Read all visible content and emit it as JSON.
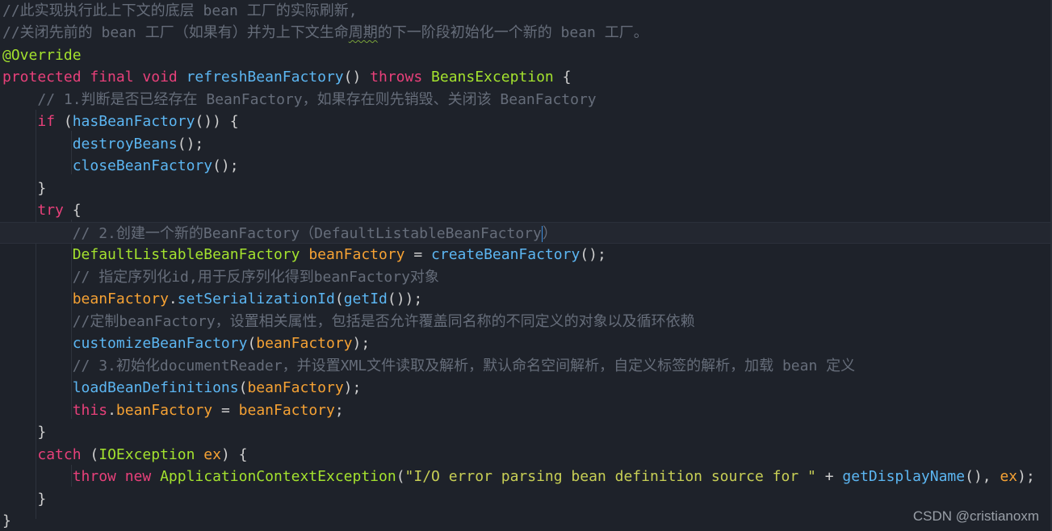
{
  "editor": {
    "lines": [
      {
        "indent": "",
        "tokens": [
          {
            "t": "cm",
            "v": "//此实现执行此上下文的底层 bean 工厂的实际刷新,"
          }
        ]
      },
      {
        "indent": "",
        "tokens": [
          {
            "t": "cm",
            "v": "//关闭先前的 bean 工厂（如果有）并为上下文生命周期的下一阶段初始化一个新的 bean 工厂。"
          }
        ]
      },
      {
        "indent": "",
        "tokens": [
          {
            "t": "ann",
            "v": "@Override"
          }
        ]
      },
      {
        "indent": "",
        "tokens": [
          {
            "t": "kw",
            "v": "protected final void "
          },
          {
            "t": "fn",
            "v": "refreshBeanFactory"
          },
          {
            "t": "pn",
            "v": "() "
          },
          {
            "t": "kw",
            "v": "throws "
          },
          {
            "t": "ty",
            "v": "BeansException"
          },
          {
            "t": "pn",
            "v": " {"
          }
        ]
      },
      {
        "indent": "    ",
        "tokens": [
          {
            "t": "cm",
            "v": "// 1.判断是否已经存在 BeanFactory，如果存在则先销毁、关闭该 BeanFactory"
          }
        ]
      },
      {
        "indent": "    ",
        "tokens": [
          {
            "t": "kw",
            "v": "if "
          },
          {
            "t": "pn",
            "v": "("
          },
          {
            "t": "fn",
            "v": "hasBeanFactory"
          },
          {
            "t": "pn",
            "v": "()) {"
          }
        ]
      },
      {
        "indent": "        ",
        "tokens": [
          {
            "t": "fn",
            "v": "destroyBeans"
          },
          {
            "t": "pn",
            "v": "();"
          }
        ]
      },
      {
        "indent": "        ",
        "tokens": [
          {
            "t": "fn",
            "v": "closeBeanFactory"
          },
          {
            "t": "pn",
            "v": "();"
          }
        ]
      },
      {
        "indent": "    ",
        "tokens": [
          {
            "t": "pn",
            "v": "}"
          }
        ]
      },
      {
        "indent": "    ",
        "tokens": [
          {
            "t": "kw",
            "v": "try "
          },
          {
            "t": "pn",
            "v": "{"
          }
        ]
      },
      {
        "indent": "        ",
        "tokens": [
          {
            "t": "cm",
            "v": "// 2.创建一个新的BeanFactory（DefaultListableBeanFactory"
          },
          {
            "t": "caret",
            "v": ""
          },
          {
            "t": "cm",
            "v": "）"
          }
        ]
      },
      {
        "indent": "        ",
        "tokens": [
          {
            "t": "ty",
            "v": "DefaultListableBeanFactory "
          },
          {
            "t": "va",
            "v": "beanFactory"
          },
          {
            "t": "pn",
            "v": " = "
          },
          {
            "t": "fn",
            "v": "createBeanFactory"
          },
          {
            "t": "pn",
            "v": "();"
          }
        ]
      },
      {
        "indent": "        ",
        "tokens": [
          {
            "t": "cm",
            "v": "// 指定序列化id,用于反序列化得到beanFactory对象"
          }
        ]
      },
      {
        "indent": "        ",
        "tokens": [
          {
            "t": "va",
            "v": "beanFactory"
          },
          {
            "t": "pn",
            "v": "."
          },
          {
            "t": "fn",
            "v": "setSerializationId"
          },
          {
            "t": "pn",
            "v": "("
          },
          {
            "t": "fn",
            "v": "getId"
          },
          {
            "t": "pn",
            "v": "());"
          }
        ]
      },
      {
        "indent": "        ",
        "tokens": [
          {
            "t": "cm",
            "v": "//定制beanFactory，设置相关属性，包括是否允许覆盖同名称的不同定义的对象以及循环依赖"
          }
        ]
      },
      {
        "indent": "        ",
        "tokens": [
          {
            "t": "fn",
            "v": "customizeBeanFactory"
          },
          {
            "t": "pn",
            "v": "("
          },
          {
            "t": "va",
            "v": "beanFactory"
          },
          {
            "t": "pn",
            "v": ");"
          }
        ]
      },
      {
        "indent": "        ",
        "tokens": [
          {
            "t": "cm",
            "v": "// 3.初始化documentReader，并设置XML文件读取及解析，默认命名空间解析，自定义标签的解析，加载 bean 定义"
          }
        ]
      },
      {
        "indent": "        ",
        "tokens": [
          {
            "t": "fn",
            "v": "loadBeanDefinitions"
          },
          {
            "t": "pn",
            "v": "("
          },
          {
            "t": "va",
            "v": "beanFactory"
          },
          {
            "t": "pn",
            "v": ");"
          }
        ]
      },
      {
        "indent": "        ",
        "tokens": [
          {
            "t": "kw",
            "v": "this"
          },
          {
            "t": "pn",
            "v": "."
          },
          {
            "t": "va",
            "v": "beanFactory"
          },
          {
            "t": "pn",
            "v": " = "
          },
          {
            "t": "va",
            "v": "beanFactory"
          },
          {
            "t": "pn",
            "v": ";"
          }
        ]
      },
      {
        "indent": "    ",
        "tokens": [
          {
            "t": "pn",
            "v": "}"
          }
        ]
      },
      {
        "indent": "    ",
        "tokens": [
          {
            "t": "kw",
            "v": "catch "
          },
          {
            "t": "pn",
            "v": "("
          },
          {
            "t": "ty",
            "v": "IOException "
          },
          {
            "t": "va",
            "v": "ex"
          },
          {
            "t": "pn",
            "v": ") {"
          }
        ]
      },
      {
        "indent": "        ",
        "tokens": [
          {
            "t": "kw",
            "v": "throw new "
          },
          {
            "t": "ty",
            "v": "ApplicationContextException"
          },
          {
            "t": "pn",
            "v": "("
          },
          {
            "t": "st",
            "v": "\"I/O error parsing bean definition source for \""
          },
          {
            "t": "pn",
            "v": " + "
          },
          {
            "t": "fn",
            "v": "getDisplayName"
          },
          {
            "t": "pn",
            "v": "(), "
          },
          {
            "t": "va",
            "v": "ex"
          },
          {
            "t": "pn",
            "v": ");"
          }
        ]
      },
      {
        "indent": "    ",
        "tokens": [
          {
            "t": "pn",
            "v": "}"
          }
        ]
      },
      {
        "indent": "",
        "tokens": [
          {
            "t": "pn",
            "v": "}"
          }
        ]
      }
    ],
    "current_line": 10,
    "squiggle": {
      "line": 1,
      "text": "周期"
    }
  },
  "watermark": "CSDN @cristianoxm"
}
